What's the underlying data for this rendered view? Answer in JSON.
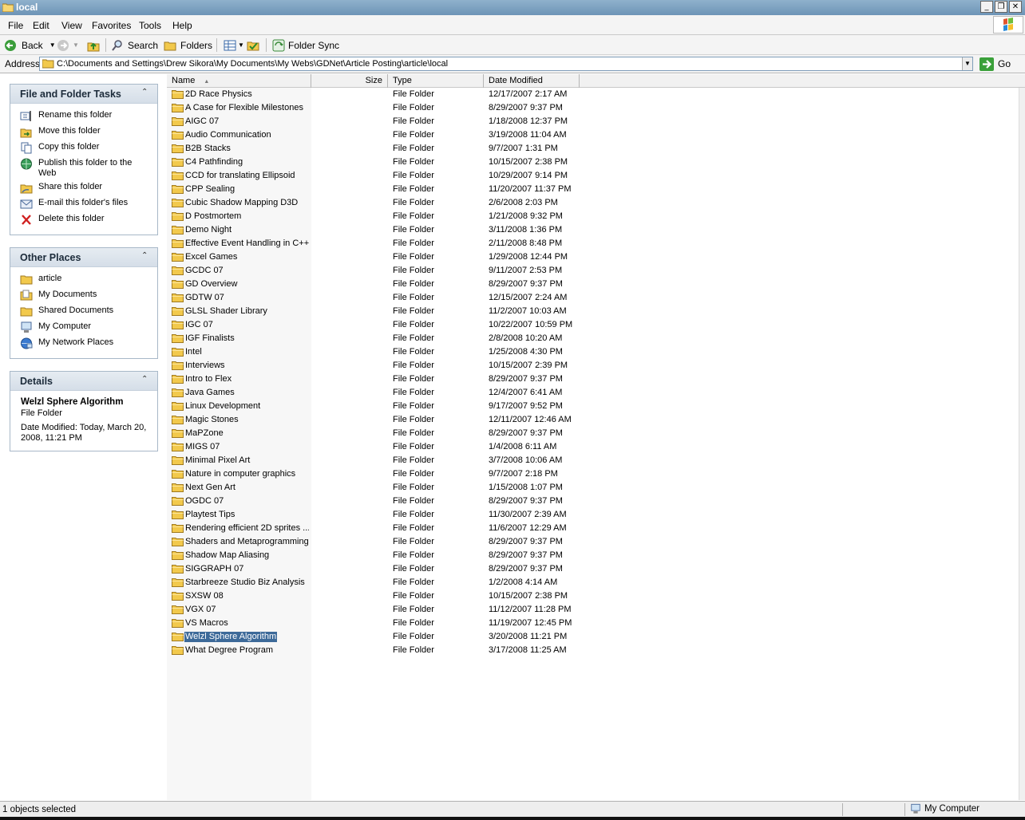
{
  "window": {
    "title": "local",
    "buttons": {
      "minimize": "_",
      "restore": "❐",
      "close": "✕"
    }
  },
  "menu": {
    "items": [
      "File",
      "Edit",
      "View",
      "Favorites",
      "Tools",
      "Help"
    ]
  },
  "toolbar": {
    "back_label": "Back",
    "search_label": "Search",
    "folders_label": "Folders",
    "folder_sync_label": "Folder Sync"
  },
  "address": {
    "label": "Address",
    "value": "C:\\Documents and Settings\\Drew Sikora\\My Documents\\My Webs\\GDNet\\Article Posting\\article\\local",
    "go_label": "Go"
  },
  "tasks_panel": {
    "title": "File and Folder Tasks",
    "items": [
      {
        "label": "Rename this folder",
        "icon": "rename-icon"
      },
      {
        "label": "Move this folder",
        "icon": "move-icon"
      },
      {
        "label": "Copy this folder",
        "icon": "copy-icon"
      },
      {
        "label": "Publish this folder to the Web",
        "icon": "globe-icon"
      },
      {
        "label": "Share this folder",
        "icon": "share-icon"
      },
      {
        "label": "E-mail this folder's files",
        "icon": "email-icon"
      },
      {
        "label": "Delete this folder",
        "icon": "delete-icon"
      }
    ]
  },
  "places_panel": {
    "title": "Other Places",
    "items": [
      {
        "label": "article",
        "icon": "folder-icon"
      },
      {
        "label": "My Documents",
        "icon": "documents-icon"
      },
      {
        "label": "Shared Documents",
        "icon": "folder-icon"
      },
      {
        "label": "My Computer",
        "icon": "computer-icon"
      },
      {
        "label": "My Network Places",
        "icon": "network-icon"
      }
    ]
  },
  "details_panel": {
    "title": "Details",
    "name": "Welzl Sphere Algorithm",
    "kind": "File Folder",
    "modified": "Date Modified: Today, March 20, 2008, 11:21 PM"
  },
  "columns": {
    "name": "Name",
    "size": "Size",
    "type": "Type",
    "date": "Date Modified"
  },
  "files": [
    {
      "name": "2D Race Physics",
      "type": "File Folder",
      "date": "12/17/2007 2:17 AM"
    },
    {
      "name": "A Case for Flexible Milestones",
      "type": "File Folder",
      "date": "8/29/2007 9:37 PM"
    },
    {
      "name": "AIGC 07",
      "type": "File Folder",
      "date": "1/18/2008 12:37 PM"
    },
    {
      "name": "Audio Communication",
      "type": "File Folder",
      "date": "3/19/2008 11:04 AM"
    },
    {
      "name": "B2B Stacks",
      "type": "File Folder",
      "date": "9/7/2007 1:31 PM"
    },
    {
      "name": "C4 Pathfinding",
      "type": "File Folder",
      "date": "10/15/2007 2:38 PM"
    },
    {
      "name": "CCD for translating Ellipsoid",
      "type": "File Folder",
      "date": "10/29/2007 9:14 PM"
    },
    {
      "name": "CPP Sealing",
      "type": "File Folder",
      "date": "11/20/2007 11:37 PM"
    },
    {
      "name": "Cubic Shadow Mapping D3D",
      "type": "File Folder",
      "date": "2/6/2008 2:03 PM"
    },
    {
      "name": "D Postmortem",
      "type": "File Folder",
      "date": "1/21/2008 9:32 PM"
    },
    {
      "name": "Demo Night",
      "type": "File Folder",
      "date": "3/11/2008 1:36 PM"
    },
    {
      "name": "Effective Event Handling in C++",
      "type": "File Folder",
      "date": "2/11/2008 8:48 PM"
    },
    {
      "name": "Excel Games",
      "type": "File Folder",
      "date": "1/29/2008 12:44 PM"
    },
    {
      "name": "GCDC 07",
      "type": "File Folder",
      "date": "9/11/2007 2:53 PM"
    },
    {
      "name": "GD Overview",
      "type": "File Folder",
      "date": "8/29/2007 9:37 PM"
    },
    {
      "name": "GDTW 07",
      "type": "File Folder",
      "date": "12/15/2007 2:24 AM"
    },
    {
      "name": "GLSL Shader Library",
      "type": "File Folder",
      "date": "11/2/2007 10:03 AM"
    },
    {
      "name": "IGC 07",
      "type": "File Folder",
      "date": "10/22/2007 10:59 PM"
    },
    {
      "name": "IGF Finalists",
      "type": "File Folder",
      "date": "2/8/2008 10:20 AM"
    },
    {
      "name": "Intel",
      "type": "File Folder",
      "date": "1/25/2008 4:30 PM"
    },
    {
      "name": "Interviews",
      "type": "File Folder",
      "date": "10/15/2007 2:39 PM"
    },
    {
      "name": "Intro to Flex",
      "type": "File Folder",
      "date": "8/29/2007 9:37 PM"
    },
    {
      "name": "Java Games",
      "type": "File Folder",
      "date": "12/4/2007 6:41 AM"
    },
    {
      "name": "Linux Development",
      "type": "File Folder",
      "date": "9/17/2007 9:52 PM"
    },
    {
      "name": "Magic Stones",
      "type": "File Folder",
      "date": "12/11/2007 12:46 AM"
    },
    {
      "name": "MaPZone",
      "type": "File Folder",
      "date": "8/29/2007 9:37 PM"
    },
    {
      "name": "MIGS 07",
      "type": "File Folder",
      "date": "1/4/2008 6:11 AM"
    },
    {
      "name": "Minimal Pixel Art",
      "type": "File Folder",
      "date": "3/7/2008 10:06 AM"
    },
    {
      "name": "Nature in computer graphics",
      "type": "File Folder",
      "date": "9/7/2007 2:18 PM"
    },
    {
      "name": "Next Gen Art",
      "type": "File Folder",
      "date": "1/15/2008 1:07 PM"
    },
    {
      "name": "OGDC 07",
      "type": "File Folder",
      "date": "8/29/2007 9:37 PM"
    },
    {
      "name": "Playtest Tips",
      "type": "File Folder",
      "date": "11/30/2007 2:39 AM"
    },
    {
      "name": "Rendering efficient 2D sprites ...",
      "type": "File Folder",
      "date": "11/6/2007 12:29 AM"
    },
    {
      "name": "Shaders and Metaprogramming",
      "type": "File Folder",
      "date": "8/29/2007 9:37 PM"
    },
    {
      "name": "Shadow Map Aliasing",
      "type": "File Folder",
      "date": "8/29/2007 9:37 PM"
    },
    {
      "name": "SIGGRAPH 07",
      "type": "File Folder",
      "date": "8/29/2007 9:37 PM"
    },
    {
      "name": "Starbreeze Studio Biz Analysis",
      "type": "File Folder",
      "date": "1/2/2008 4:14 AM"
    },
    {
      "name": "SXSW 08",
      "type": "File Folder",
      "date": "10/15/2007 2:38 PM"
    },
    {
      "name": "VGX 07",
      "type": "File Folder",
      "date": "11/12/2007 11:28 PM"
    },
    {
      "name": "VS Macros",
      "type": "File Folder",
      "date": "11/19/2007 12:45 PM"
    },
    {
      "name": "Welzl Sphere Algorithm",
      "type": "File Folder",
      "date": "3/20/2008 11:21 PM",
      "selected": true
    },
    {
      "name": "What Degree Program",
      "type": "File Folder",
      "date": "3/17/2008 11:25 AM"
    }
  ],
  "status": {
    "selection": "1 objects selected",
    "zone": "My Computer"
  },
  "colors": {
    "selection": "#3d6a99",
    "titlebar": "#7a9fbf",
    "folder": "#f2c94c"
  }
}
